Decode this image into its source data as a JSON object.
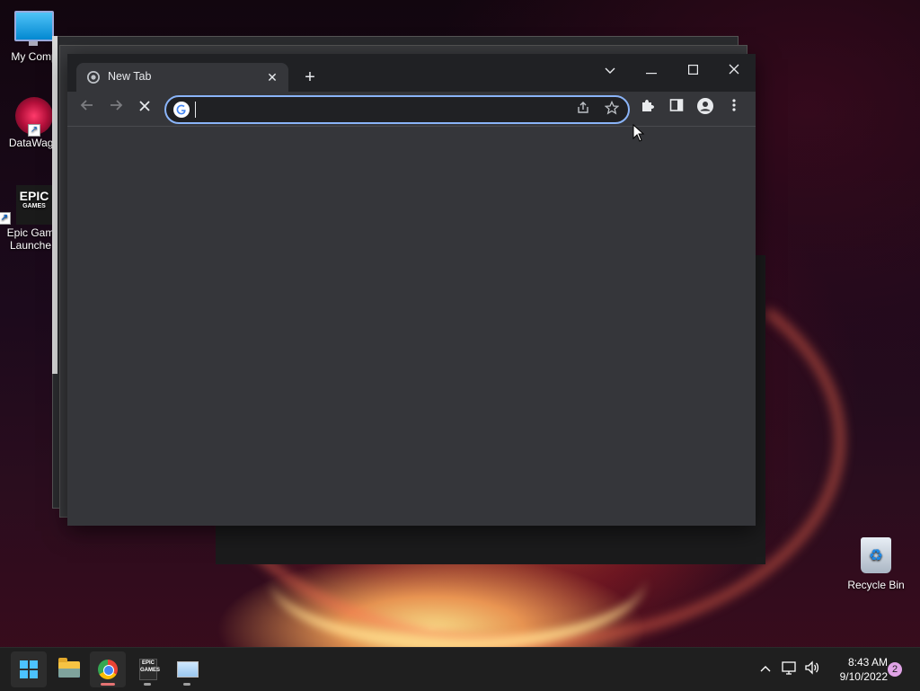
{
  "desktop": {
    "icons": [
      {
        "label": "My Comp"
      },
      {
        "label": "DataWago"
      },
      {
        "label": "Epic Gam Launche"
      }
    ],
    "epic_logo_text": "EPIC",
    "epic_logo_sub": "GAMES",
    "recycle_bin_label": "Recycle Bin"
  },
  "browser": {
    "tab": {
      "title": "New Tab",
      "close_glyph": "✕"
    },
    "new_tab_glyph": "+",
    "window_controls": {
      "tabsearch": "⌄",
      "minimize": "—",
      "maximize": "☐",
      "close": "✕"
    },
    "toolbar": {
      "back_glyph": "←",
      "forward_glyph": "→",
      "stop_glyph": "✕",
      "omnibox_value": "",
      "omnibox_placeholder": "",
      "share_glyph": "⇪",
      "bookmark_glyph": "☆",
      "extensions_glyph": "✚",
      "sidepanel_glyph": "▮",
      "profile_glyph": "●",
      "menu_glyph": "⋮"
    }
  },
  "taskbar": {
    "epic_small_text": "EPIC GAMES",
    "tray": {
      "chevron": "^",
      "network": "▭",
      "volume": "🔈"
    },
    "clock": {
      "time": "8:43 AM",
      "date": "9/10/2022"
    },
    "notifications": "2"
  },
  "colors": {
    "chrome_frame": "#202124",
    "chrome_surface": "#35363a",
    "omnibox_focus": "#8ab4f8",
    "taskbar": "#1f1f1f",
    "start_accent": "#4cc2ff"
  }
}
